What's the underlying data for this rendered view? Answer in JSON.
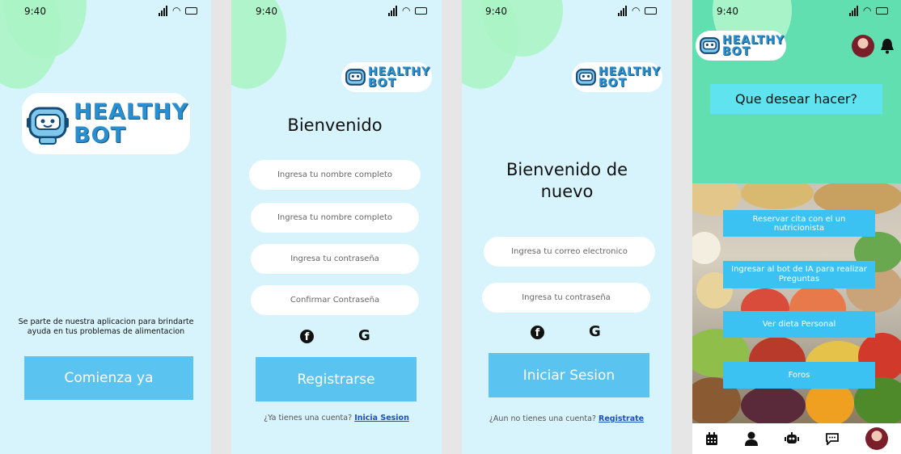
{
  "status": {
    "time": "9:40"
  },
  "logo": {
    "line1": "HEALTHY",
    "line2": "BOT"
  },
  "screen1": {
    "tagline": "Se parte de nuestra aplicacion para brindarte ayuda en tus problemas de alimentacion",
    "cta": "Comienza ya"
  },
  "screen2": {
    "title": "Bienvenido",
    "fields": [
      "Ingresa tu nombre completo",
      "Ingresa tu nombre completo",
      "Ingresa tu contraseña",
      "Confirmar Contraseña"
    ],
    "cta": "Registrarse",
    "footer_text": "¿Ya tienes una cuenta?",
    "footer_link": "Inicia Sesion"
  },
  "screen3": {
    "title": "Bienvenido de nuevo",
    "fields": [
      "Ingresa tu correo electronico",
      "Ingresa tu contraseña"
    ],
    "cta": "Iniciar Sesion",
    "footer_text": "¿Aun no tienes una cuenta?",
    "footer_link": "Registrate"
  },
  "screen4": {
    "question": "Que desear hacer?",
    "options": [
      "Reservar cita con el un nutricionista",
      "Ingresar al bot de IA para realizar Preguntas",
      "Ver dieta Personal",
      "Foros"
    ],
    "nav": [
      "calendar-icon",
      "user-icon",
      "bot-icon",
      "chat-icon",
      "profile-avatar"
    ]
  },
  "colors": {
    "background": "#d7f4fc",
    "accent": "#5ac3ef",
    "home_header": "#62dfb0",
    "logo_text": "#2a8fd0"
  }
}
